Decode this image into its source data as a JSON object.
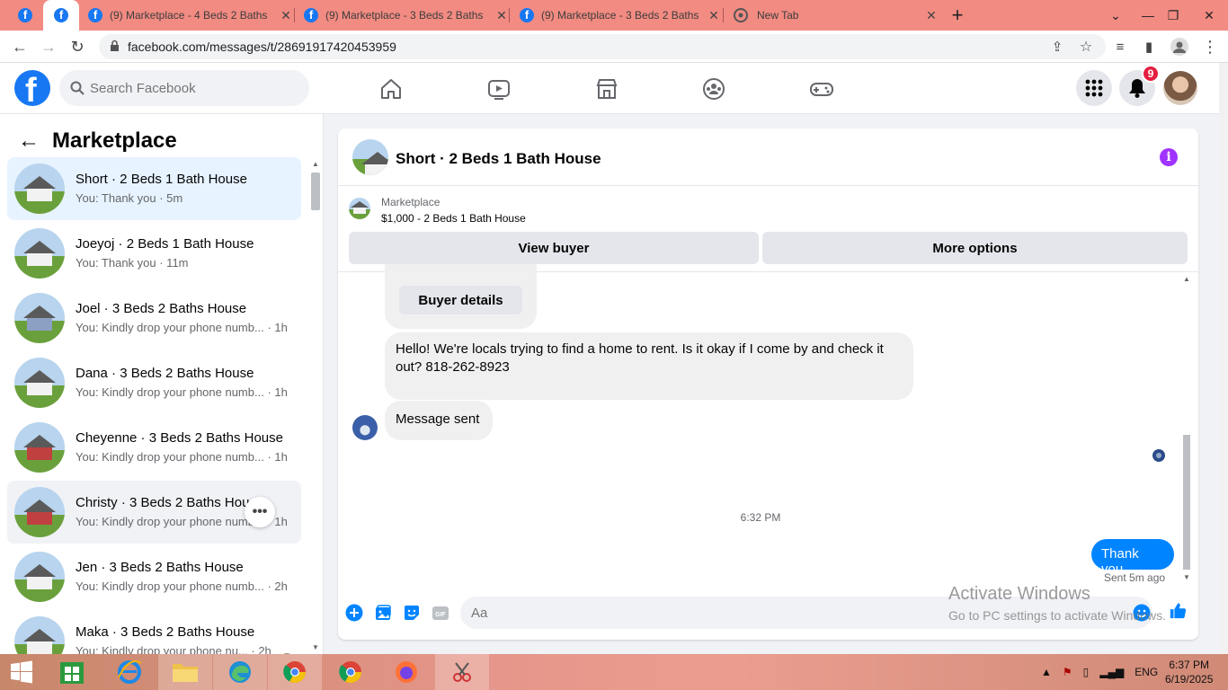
{
  "browser": {
    "tabs": [
      {
        "title": "",
        "icon": "facebook-icon",
        "active": false
      },
      {
        "title": "",
        "icon": "facebook-icon",
        "active": true
      },
      {
        "title": "(9) Marketplace - 4 Beds 2 Baths",
        "icon": "facebook-icon",
        "active": false
      },
      {
        "title": "(9) Marketplace - 3 Beds 2 Baths",
        "icon": "facebook-icon",
        "active": false
      },
      {
        "title": "(9) Marketplace - 3 Beds 2 Baths",
        "icon": "facebook-icon",
        "active": false
      },
      {
        "title": "New Tab",
        "icon": "chrome-icon",
        "active": false
      }
    ],
    "url": "facebook.com/messages/t/28691917420453959"
  },
  "header": {
    "logo": "f",
    "search_placeholder": "Search Facebook",
    "notification_count": "9"
  },
  "sidebar": {
    "title": "Marketplace",
    "conversations": [
      {
        "name": "Short · 2 Beds 1 Bath House",
        "preview": "You: Thank you · 5m",
        "thumb": "white"
      },
      {
        "name": "Joeyoj · 2 Beds 1 Bath House",
        "preview": "You: Thank you · 11m",
        "thumb": "white"
      },
      {
        "name": "Joel · 3 Beds 2 Baths House",
        "preview": "You: Kindly drop your phone numb... · 1h",
        "thumb": "blue"
      },
      {
        "name": "Dana · 3 Beds 2 Baths House",
        "preview": "You: Kindly drop your phone numb... · 1h",
        "thumb": "white"
      },
      {
        "name": "Cheyenne · 3 Beds 2 Baths House",
        "preview": "You: Kindly drop your phone numb... · 1h",
        "thumb": "red"
      },
      {
        "name": "Christy · 3 Beds 2 Baths House",
        "preview": "You: Kindly drop your phone numb... · 1h",
        "thumb": "red"
      },
      {
        "name": "Jen · 3 Beds 2 Baths House",
        "preview": "You: Kindly drop your phone numb... · 2h",
        "thumb": "white"
      },
      {
        "name": "Maka · 3 Beds 2 Baths House",
        "preview": "You: Kindly drop your phone nu... · 2h",
        "thumb": "white"
      }
    ]
  },
  "chat": {
    "title": "Short · 2 Beds 1 Bath House",
    "listing_source": "Marketplace",
    "listing_price": "$1,000 - 2 Beds 1 Bath House",
    "view_buyer": "View buyer",
    "more_options": "More options",
    "buyer_details": "Buyer details",
    "incoming_message": "Hello!  We're locals trying to find a home to rent.  Is it okay if I come by and check it out? 818-262-8923",
    "status_message": "Message sent",
    "timestamp": "6:32 PM",
    "my_message": "Thank you",
    "sent_status": "Sent 5m ago",
    "composer_placeholder": "Aa"
  },
  "watermark": {
    "line1": "Activate Windows",
    "line2": "Go to PC settings to activate Windows."
  },
  "taskbar": {
    "language": "ENG",
    "time": "6:37 PM",
    "date": "6/19/2025"
  }
}
